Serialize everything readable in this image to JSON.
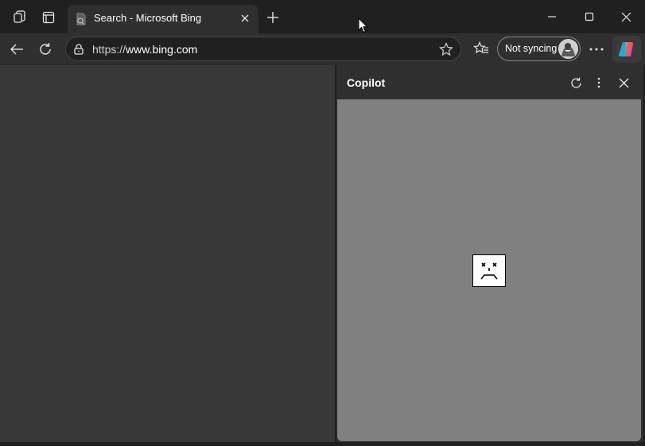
{
  "titlebar": {
    "tab": {
      "title": "Search - Microsoft Bing",
      "favicon": "bing-favicon",
      "close_icon": "close-icon"
    },
    "icons": {
      "workspaces": "workspaces-icon",
      "tab_actions": "tab-actions-icon",
      "new_tab": "plus-icon",
      "minimize": "minimize-icon",
      "maximize": "maximize-icon",
      "close": "close-icon"
    }
  },
  "toolbar": {
    "url_scheme": "https://",
    "url_host": "www.bing.com",
    "profile_label": "Not syncing",
    "icons": {
      "back": "back-arrow-icon",
      "refresh": "refresh-icon",
      "lock": "lock-icon",
      "favorite": "star-icon",
      "favorites": "favorites-icon",
      "more": "more-horizontal-icon",
      "copilot": "copilot-icon"
    }
  },
  "sidepane": {
    "title": "Copilot",
    "icons": {
      "refresh": "refresh-icon",
      "more": "more-vertical-icon",
      "close": "close-icon"
    },
    "content_state": "error",
    "error_icon": "sad-face-icon"
  },
  "colors": {
    "titlebar_bg": "#202020",
    "toolbar_bg": "#2f2f2f",
    "page_bg": "#383838",
    "sidepane_content_bg": "#808080"
  }
}
